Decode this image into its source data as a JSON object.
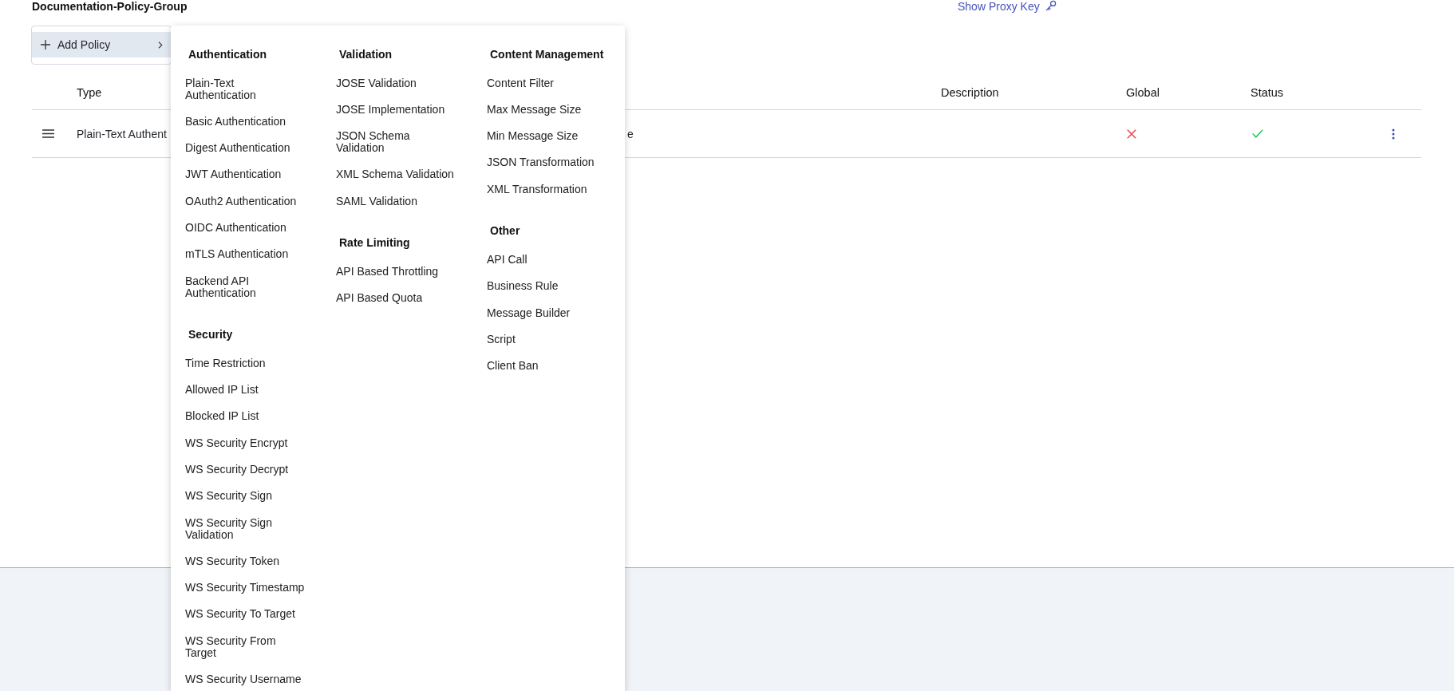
{
  "header": {
    "title": "Documentation-Policy-Group",
    "proxy_key_link": "Show Proxy Key"
  },
  "add_policy": {
    "label": "Add Policy",
    "expanded": true
  },
  "table": {
    "columns": [
      "Type",
      "Description",
      "Global",
      "Status"
    ],
    "rows": [
      {
        "type": "Plain-Text Authent",
        "column_3": "e",
        "global": false,
        "enabled": true
      }
    ]
  },
  "policy_menu": {
    "columns": [
      {
        "sections": [
          {
            "title": "Authentication",
            "items": [
              "Plain-Text Authentication",
              "Basic Authentication",
              "Digest Authentication",
              "JWT Authentication",
              "OAuth2 Authentication",
              "OIDC Authentication",
              "mTLS Authentication",
              "Backend API Authentication"
            ]
          },
          {
            "title": "Security",
            "items": [
              "Time Restriction",
              "Allowed IP List",
              "Blocked IP List",
              "WS Security Encrypt",
              "WS Security Decrypt",
              "WS Security Sign",
              "WS Security Sign Validation",
              "WS Security Token",
              "WS Security Timestamp",
              "WS Security To Target",
              "WS Security From Target",
              "WS Security Username"
            ]
          }
        ]
      },
      {
        "sections": [
          {
            "title": "Validation",
            "items": [
              "JOSE Validation",
              "JOSE Implementation",
              "JSON Schema Validation",
              "XML Schema Validation",
              "SAML Validation"
            ]
          },
          {
            "title": "Rate Limiting",
            "items": [
              "API Based Throttling",
              "API Based Quota"
            ]
          }
        ]
      },
      {
        "sections": [
          {
            "title": "Content Management",
            "items": [
              "Content Filter",
              "Max Message Size",
              "Min Message Size",
              "JSON Transformation",
              "XML Transformation"
            ]
          },
          {
            "title": "Other",
            "items": [
              "API Call",
              "Business Rule",
              "Message Builder",
              "Script",
              "Client Ban"
            ]
          }
        ]
      }
    ]
  }
}
